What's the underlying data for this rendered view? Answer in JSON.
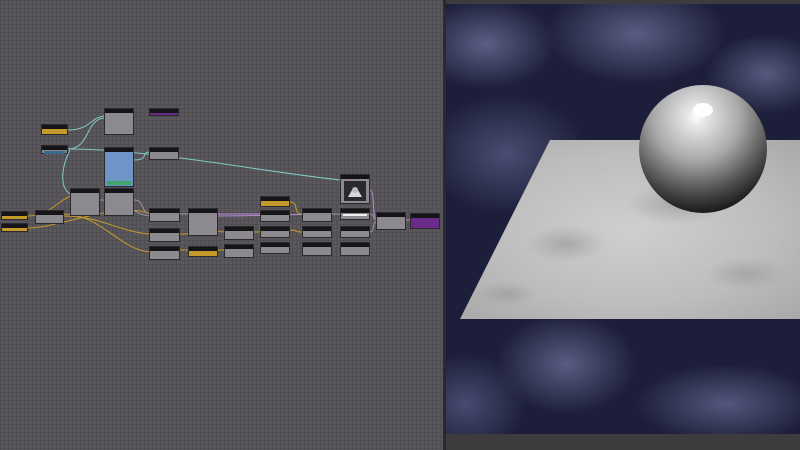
{
  "app": {
    "panels": [
      "node-graph",
      "3d-preview"
    ]
  },
  "colors": {
    "graph_bg": "#5a585c",
    "node_body": "#8c8a8e",
    "node_header": "#151416",
    "constant_node": "#c49a2a",
    "output_node": "#6a2a8a",
    "texture_node": "#6f95c8",
    "wire_cyan": "#7fc9c4",
    "wire_gold": "#c49a2a",
    "sky": "#1d1f3a"
  },
  "preview": {
    "objects": [
      "sphere",
      "plane"
    ]
  }
}
